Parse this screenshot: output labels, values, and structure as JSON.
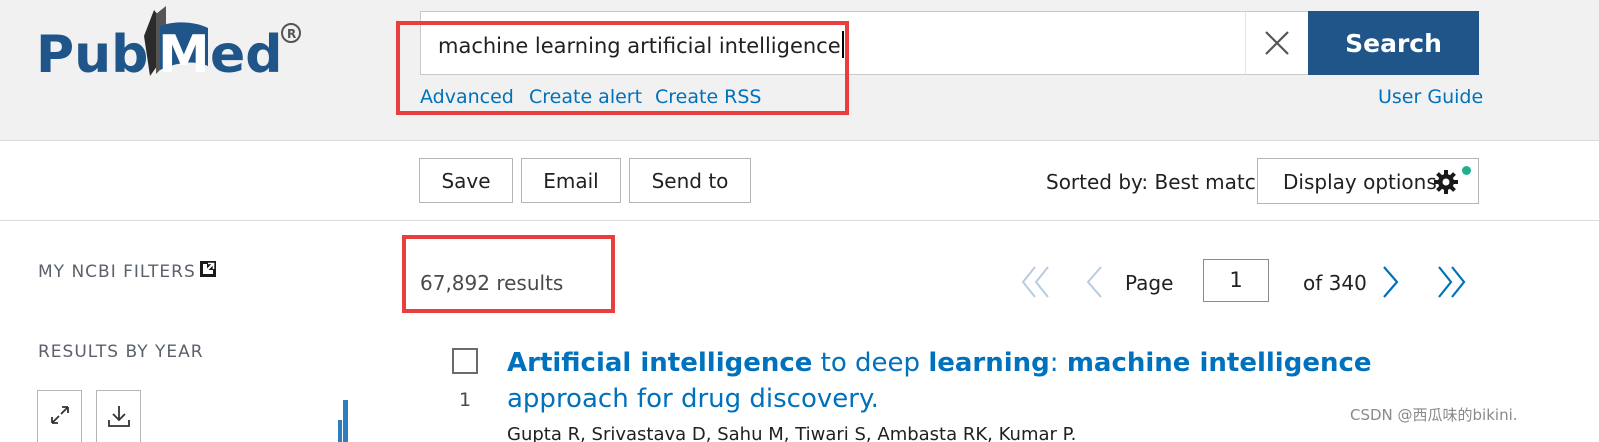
{
  "logo": {
    "text": "PubMed",
    "registered": "®"
  },
  "search": {
    "query": "machine learning artificial intelligence",
    "button_label": "Search",
    "links": [
      "Advanced",
      "Create alert",
      "Create RSS"
    ],
    "user_guide": "User Guide"
  },
  "toolbar": {
    "save_label": "Save",
    "email_label": "Email",
    "send_to_label": "Send to",
    "sorted_by": "Sorted by: Best match",
    "display_options_label": "Display options"
  },
  "sidebar": {
    "filters_title": "MY NCBI FILTERS",
    "results_by_year_title": "RESULTS BY YEAR"
  },
  "results": {
    "count_text": "67,892 results",
    "pagination": {
      "page_label": "Page",
      "current_page": "1",
      "of_text": "of 340"
    },
    "items": [
      {
        "number": "1",
        "title_parts": [
          {
            "text": "Artificial intelligence",
            "bold": true
          },
          {
            "text": " to deep ",
            "bold": false
          },
          {
            "text": "learning",
            "bold": true
          },
          {
            "text": ": ",
            "bold": false
          },
          {
            "text": "machine intelligence",
            "bold": true
          },
          {
            "text": " approach for drug discovery.",
            "bold": false
          }
        ],
        "authors": "Gupta R, Srivastava D, Sahu M, Tiwari S, Ambasta RK, Kumar P."
      }
    ]
  },
  "watermark": "CSDN @西瓜味的bikini.",
  "colors": {
    "brand_blue": "#20558a",
    "link_blue": "#0071bc",
    "highlight_red": "#e83e3e",
    "notification_green": "#20b08f"
  },
  "icons": [
    "pubmed-logo",
    "clear-icon",
    "gear-icon",
    "external-link-icon",
    "expand-icon",
    "download-icon",
    "first-page-icon",
    "prev-page-icon",
    "next-page-icon",
    "last-page-icon"
  ]
}
